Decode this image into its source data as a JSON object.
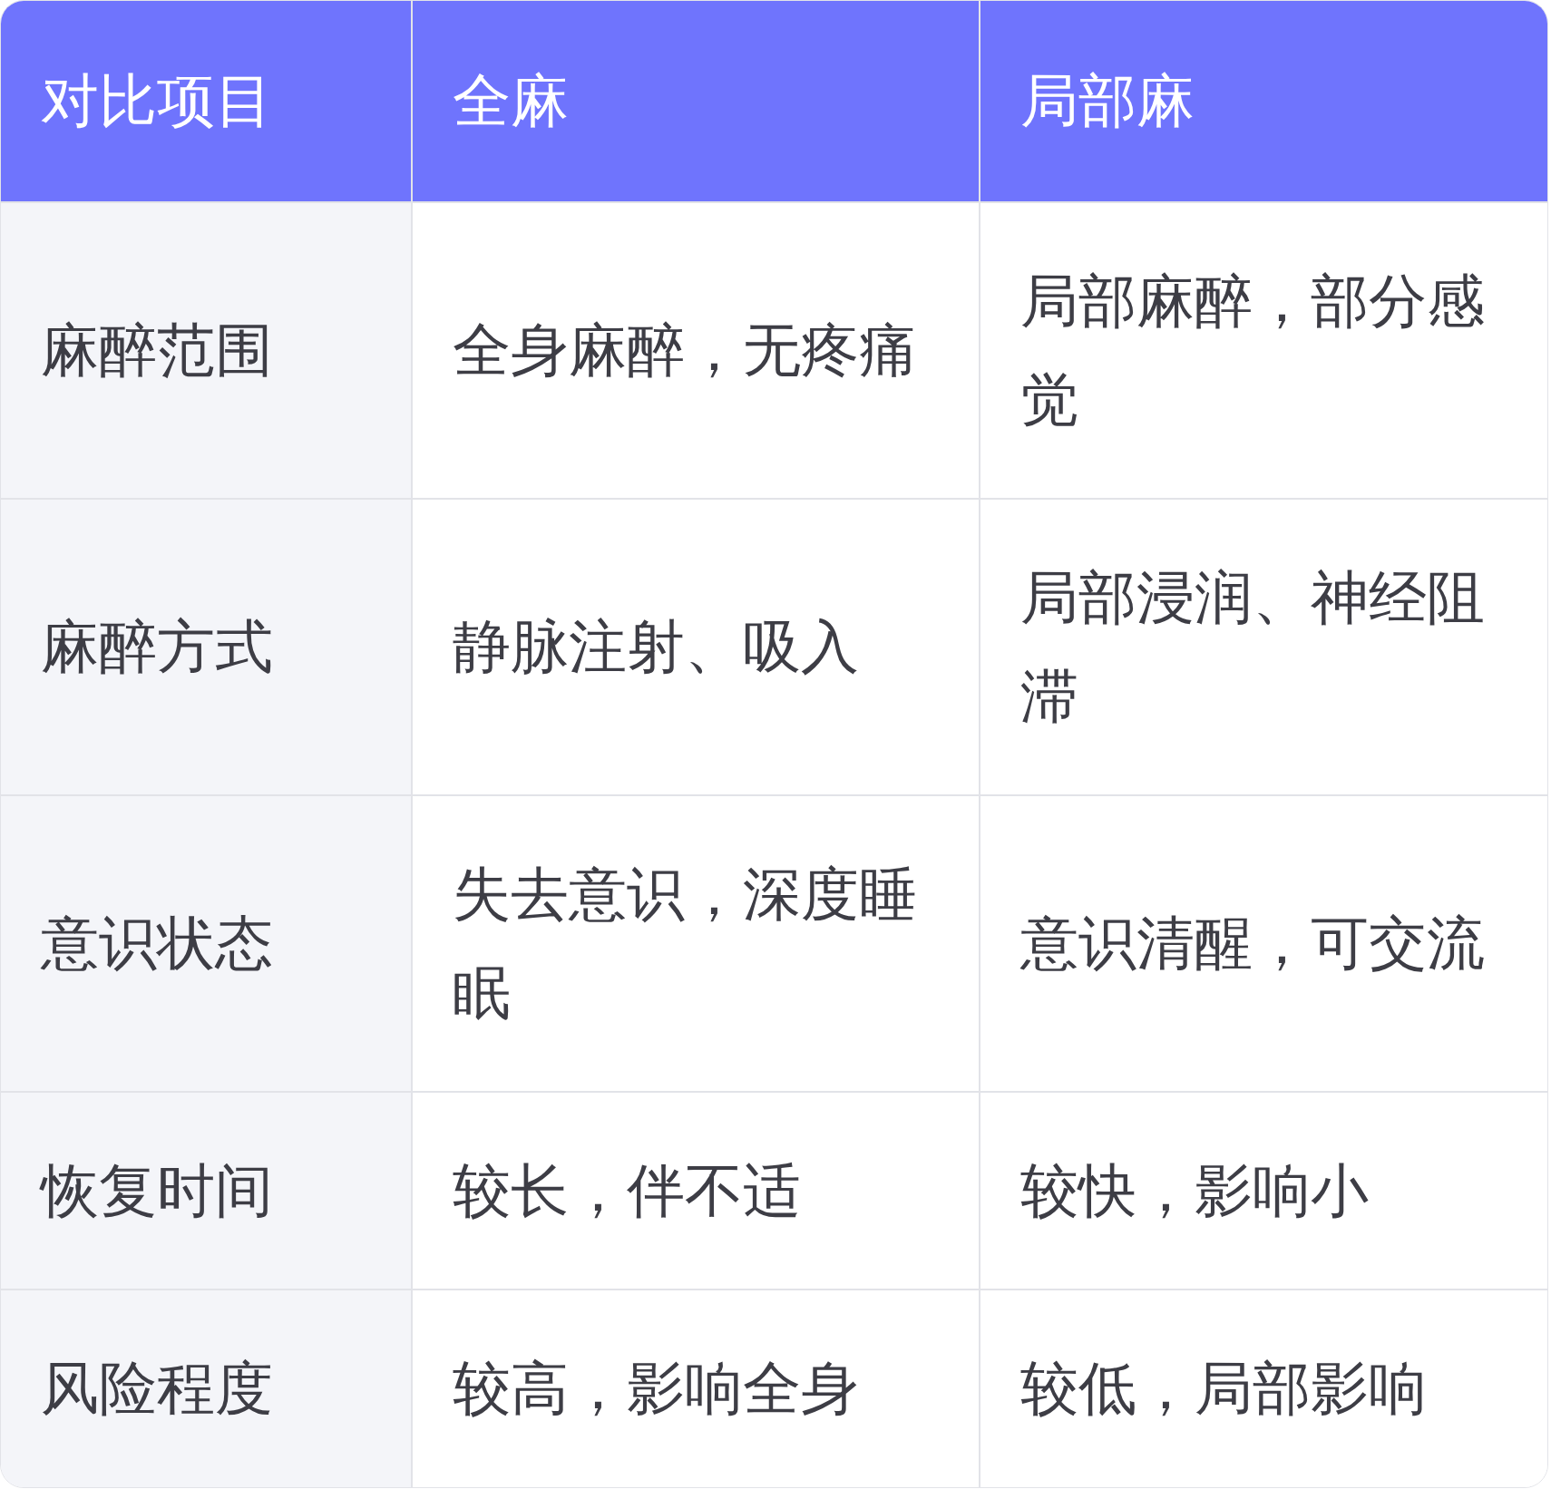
{
  "table": {
    "columns": [
      "对比项目",
      "全麻",
      "局部麻"
    ],
    "rows": [
      [
        "麻醉范围",
        "全身麻醉，无疼痛",
        "局部麻醉，部分感觉"
      ],
      [
        "麻醉方式",
        "静脉注射、吸入",
        "局部浸润、神经阻滞"
      ],
      [
        "意识状态",
        "失去意识，深度睡眠",
        "意识清醒，可交流"
      ],
      [
        "恢复时间",
        "较长，伴不适",
        "较快，影响小"
      ],
      [
        "风险程度",
        "较高，影响全身",
        "较低，局部影响"
      ]
    ]
  }
}
